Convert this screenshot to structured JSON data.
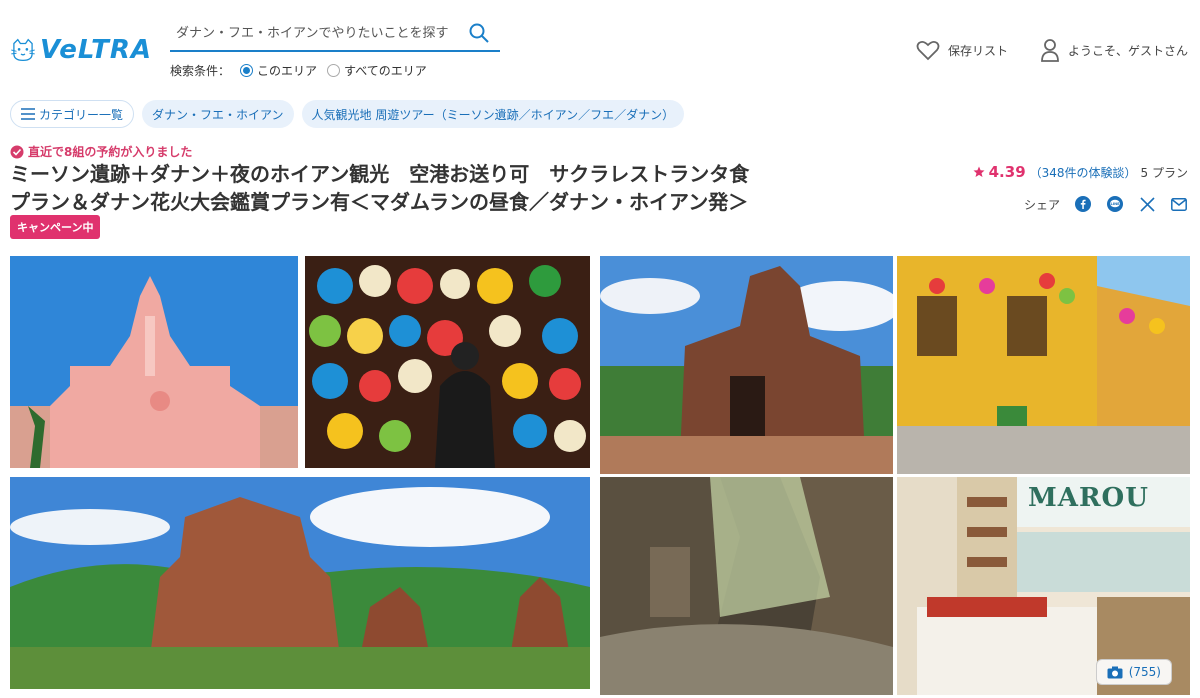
{
  "header": {
    "logo_text": "VeLTRA",
    "search_placeholder": "ダナン・フエ・ホイアンでやりたいことを探す",
    "search_label": "検索条件：",
    "search_options": [
      "このエリア",
      "すべてのエリア"
    ],
    "saved_list": "保存リスト",
    "welcome": "ようこそ、ゲストさん"
  },
  "chips": [
    "カテゴリー一覧",
    "ダナン・フエ・ホイアン",
    "人気観光地 周遊ツアー（ミーソン遺跡／ホイアン／フエ／ダナン）"
  ],
  "notice": "直近で8組の予約が入りました",
  "title_line1": "ミーソン遺跡＋ダナン＋夜のホイアン観光　空港お送り可　サクラレストランタ食",
  "title_line2": "プラン＆ダナン花火大会鑑賞プラン有＜マダムランの昼食／ダナン・ホイアン発＞",
  "badge": "キャンペーン中",
  "rating": {
    "score": "4.39",
    "reviews": "（348件の体験談）",
    "plans": "5 プラン"
  },
  "share_label": "シェア",
  "photo_count": "(755)",
  "shop_sign": "MAROU",
  "colors": {
    "accent": "#1a7fc9",
    "brand": "#1a8fd6",
    "pink": "#e0326e"
  }
}
